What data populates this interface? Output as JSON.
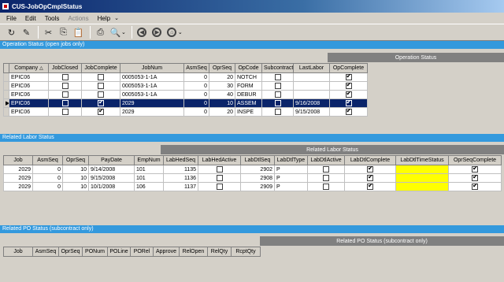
{
  "window": {
    "title": "CUS-JobOpCmplStatus"
  },
  "menu": [
    {
      "label": "File",
      "disabled": false
    },
    {
      "label": "Edit",
      "disabled": false
    },
    {
      "label": "Tools",
      "disabled": false
    },
    {
      "label": "Actions",
      "disabled": true
    },
    {
      "label": "Help",
      "disabled": false
    }
  ],
  "menu_more": "⌄",
  "toolbar": {
    "refresh": "↻",
    "clear": "✎",
    "cut": "✂",
    "copy": "⎘",
    "paste": "📋",
    "print": "⎙",
    "search": "🔍",
    "back": "◀",
    "forward": "▶",
    "home": "⌂",
    "chevron": "⌄"
  },
  "operation": {
    "section_title": "Operation Status (open jobs only)",
    "group_title": "Operation Status",
    "columns": [
      "Company",
      "JobClosed",
      "JobComplete",
      "JobNum",
      "AsmSeq",
      "OprSeq",
      "OpCode",
      "Subcontract",
      "LastLabor",
      "OpComplete"
    ],
    "rows": [
      {
        "company": "EPIC06",
        "job_closed": false,
        "job_complete": false,
        "job_num": "0005053-1-1A",
        "asm_seq": "0",
        "opr_seq": "20",
        "op_code": "NOTCH",
        "subcontract": false,
        "last_labor": "",
        "op_complete": true,
        "selected": false
      },
      {
        "company": "EPIC06",
        "job_closed": false,
        "job_complete": false,
        "job_num": "0005053-1-1A",
        "asm_seq": "0",
        "opr_seq": "30",
        "op_code": "FORM",
        "subcontract": false,
        "last_labor": "",
        "op_complete": true,
        "selected": false
      },
      {
        "company": "EPIC06",
        "job_closed": false,
        "job_complete": false,
        "job_num": "0005053-1-1A",
        "asm_seq": "0",
        "opr_seq": "40",
        "op_code": "DEBUR",
        "subcontract": false,
        "last_labor": "",
        "op_complete": true,
        "selected": false
      },
      {
        "company": "EPIC06",
        "job_closed": false,
        "job_complete": true,
        "job_num": "2029",
        "asm_seq": "0",
        "opr_seq": "10",
        "op_code": "ASSEM",
        "subcontract": false,
        "last_labor": "9/16/2008",
        "op_complete": true,
        "selected": true
      },
      {
        "company": "EPIC06",
        "job_closed": false,
        "job_complete": true,
        "job_num": "2029",
        "asm_seq": "0",
        "opr_seq": "20",
        "op_code": "INSPE",
        "subcontract": false,
        "last_labor": "9/15/2008",
        "op_complete": true,
        "selected": false
      }
    ]
  },
  "labor": {
    "section_title": "Related Labor Status",
    "group_title": "Related Labor Status",
    "columns": [
      "Job",
      "AsmSeq",
      "OprSeq",
      "PayDate",
      "EmpNum",
      "LabHedSeq",
      "LabHedActive",
      "LabDtlSeq",
      "LabDtlType",
      "LabDtlActive",
      "LabDtlComplete",
      "LabDtlTimeStatus",
      "OprSeqComplete"
    ],
    "rows": [
      {
        "job": "2029",
        "asm_seq": "0",
        "opr_seq": "10",
        "pay_date": "9/14/2008",
        "emp_num": "101",
        "lab_hed_seq": "1135",
        "lab_hed_active": false,
        "lab_dtl_seq": "2902",
        "lab_dtl_type": "P",
        "lab_dtl_active": false,
        "lab_dtl_complete": true,
        "lab_dtl_time_status": "",
        "opr_seq_complete": true
      },
      {
        "job": "2029",
        "asm_seq": "0",
        "opr_seq": "10",
        "pay_date": "9/15/2008",
        "emp_num": "101",
        "lab_hed_seq": "1136",
        "lab_hed_active": false,
        "lab_dtl_seq": "2908",
        "lab_dtl_type": "P",
        "lab_dtl_active": false,
        "lab_dtl_complete": true,
        "lab_dtl_time_status": "",
        "opr_seq_complete": true
      },
      {
        "job": "2029",
        "asm_seq": "0",
        "opr_seq": "10",
        "pay_date": "10/1/2008",
        "emp_num": "106",
        "lab_hed_seq": "1137",
        "lab_hed_active": false,
        "lab_dtl_seq": "2909",
        "lab_dtl_type": "P",
        "lab_dtl_active": false,
        "lab_dtl_complete": true,
        "lab_dtl_time_status": "",
        "opr_seq_complete": true
      }
    ]
  },
  "po": {
    "section_title": "Related PO Status (subcontract only)",
    "group_title": "Related PO Status (subcontract only)",
    "columns": [
      "Job",
      "AsmSeq",
      "OprSeq",
      "PONum",
      "POLine",
      "PORel",
      "Approve",
      "RelOpen",
      "RelQty",
      "RcptQty"
    ]
  },
  "colors": {
    "section": "#3399dd",
    "selected": "#0a246a",
    "highlight": "#ffff00"
  }
}
